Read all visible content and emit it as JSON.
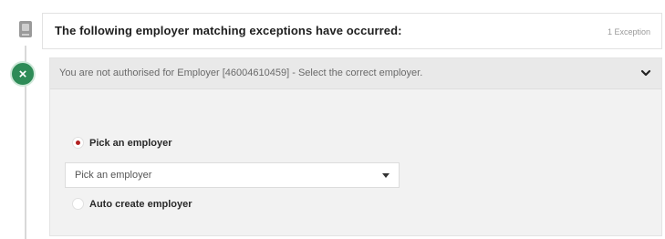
{
  "header": {
    "title": "The following employer matching exceptions have occurred:",
    "count": "1 Exception",
    "icon": "document-icon"
  },
  "exception": {
    "status_icon": "close-icon",
    "message": "You are not authorised for Employer [46004610459] - Select the correct employer.",
    "toggle_icon": "chevron-down-icon"
  },
  "options": {
    "pick": {
      "label": "Pick an employer",
      "selected": true
    },
    "select": {
      "value": "Pick an employer"
    },
    "auto": {
      "label": "Auto create employer",
      "selected": false
    }
  },
  "colors": {
    "status": "#2e8b57",
    "radio_selected": "#b22222",
    "panel_bg": "#f2f2f2"
  }
}
